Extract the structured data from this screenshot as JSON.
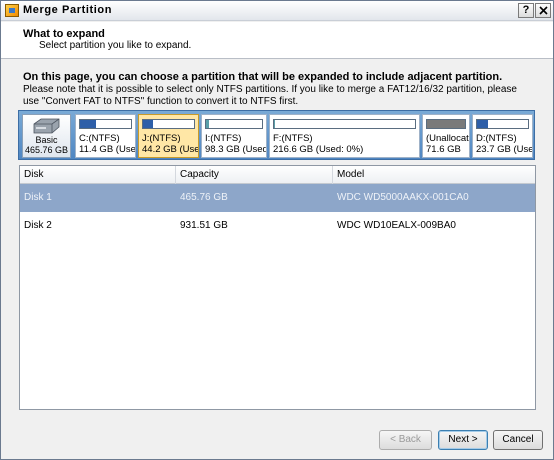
{
  "window": {
    "title": "Merge Partition"
  },
  "titlebar": {
    "help_label": "?",
    "close_label": "X"
  },
  "header": {
    "title": "What to expand",
    "subtitle": "Select partition you like to expand."
  },
  "description": {
    "bold_text": "On this page, you can choose a partition that will be expanded to include adjacent partition.",
    "text": "Please note that it is possible to select only NTFS partitions. If you like to merge a FAT12/16/32 partition, please use \"Convert FAT to NTFS\" function to convert it to NTFS first."
  },
  "disk_map": {
    "disk": {
      "type": "Basic",
      "size": "465.76 GB",
      "icon": "hard-disk-icon"
    },
    "partitions": [
      {
        "label": "C:(NTFS)",
        "info": "11.4 GB (Usec",
        "used_fraction": 0.32,
        "color": "#2e5fa8",
        "selected": false
      },
      {
        "label": "J:(NTFS)",
        "info": "44.2 GB (Usec",
        "used_fraction": 0.2,
        "color": "#2e5fa8",
        "selected": true
      },
      {
        "label": "I:(NTFS)",
        "info": "98.3 GB (Used:",
        "used_fraction": 0.06,
        "color": "#5aa0a8",
        "selected": false
      },
      {
        "label": "F:(NTFS)",
        "info": "216.6 GB (Used: 0%)",
        "used_fraction": 0.01,
        "color": "#5aa0a8",
        "selected": false
      },
      {
        "label": "(Unallocate",
        "info": "71.6 GB",
        "used_fraction": 1.0,
        "color": "#7a7a7a",
        "selected": false
      },
      {
        "label": "D:(NTFS)",
        "info": "23.7 GB (Usec",
        "used_fraction": 0.22,
        "color": "#2e5fa8",
        "selected": false
      }
    ]
  },
  "disk_table": {
    "columns": [
      "Disk",
      "Capacity",
      "Model"
    ],
    "rows": [
      {
        "disk": "Disk 1",
        "capacity": "465.76 GB",
        "model": "WDC WD5000AAKX-001CA0",
        "selected": true
      },
      {
        "disk": "Disk 2",
        "capacity": "931.51 GB",
        "model": "WDC WD10EALX-009BA0",
        "selected": false
      }
    ]
  },
  "buttons": {
    "back": "Back",
    "next": "Next",
    "cancel": "Cancel"
  }
}
